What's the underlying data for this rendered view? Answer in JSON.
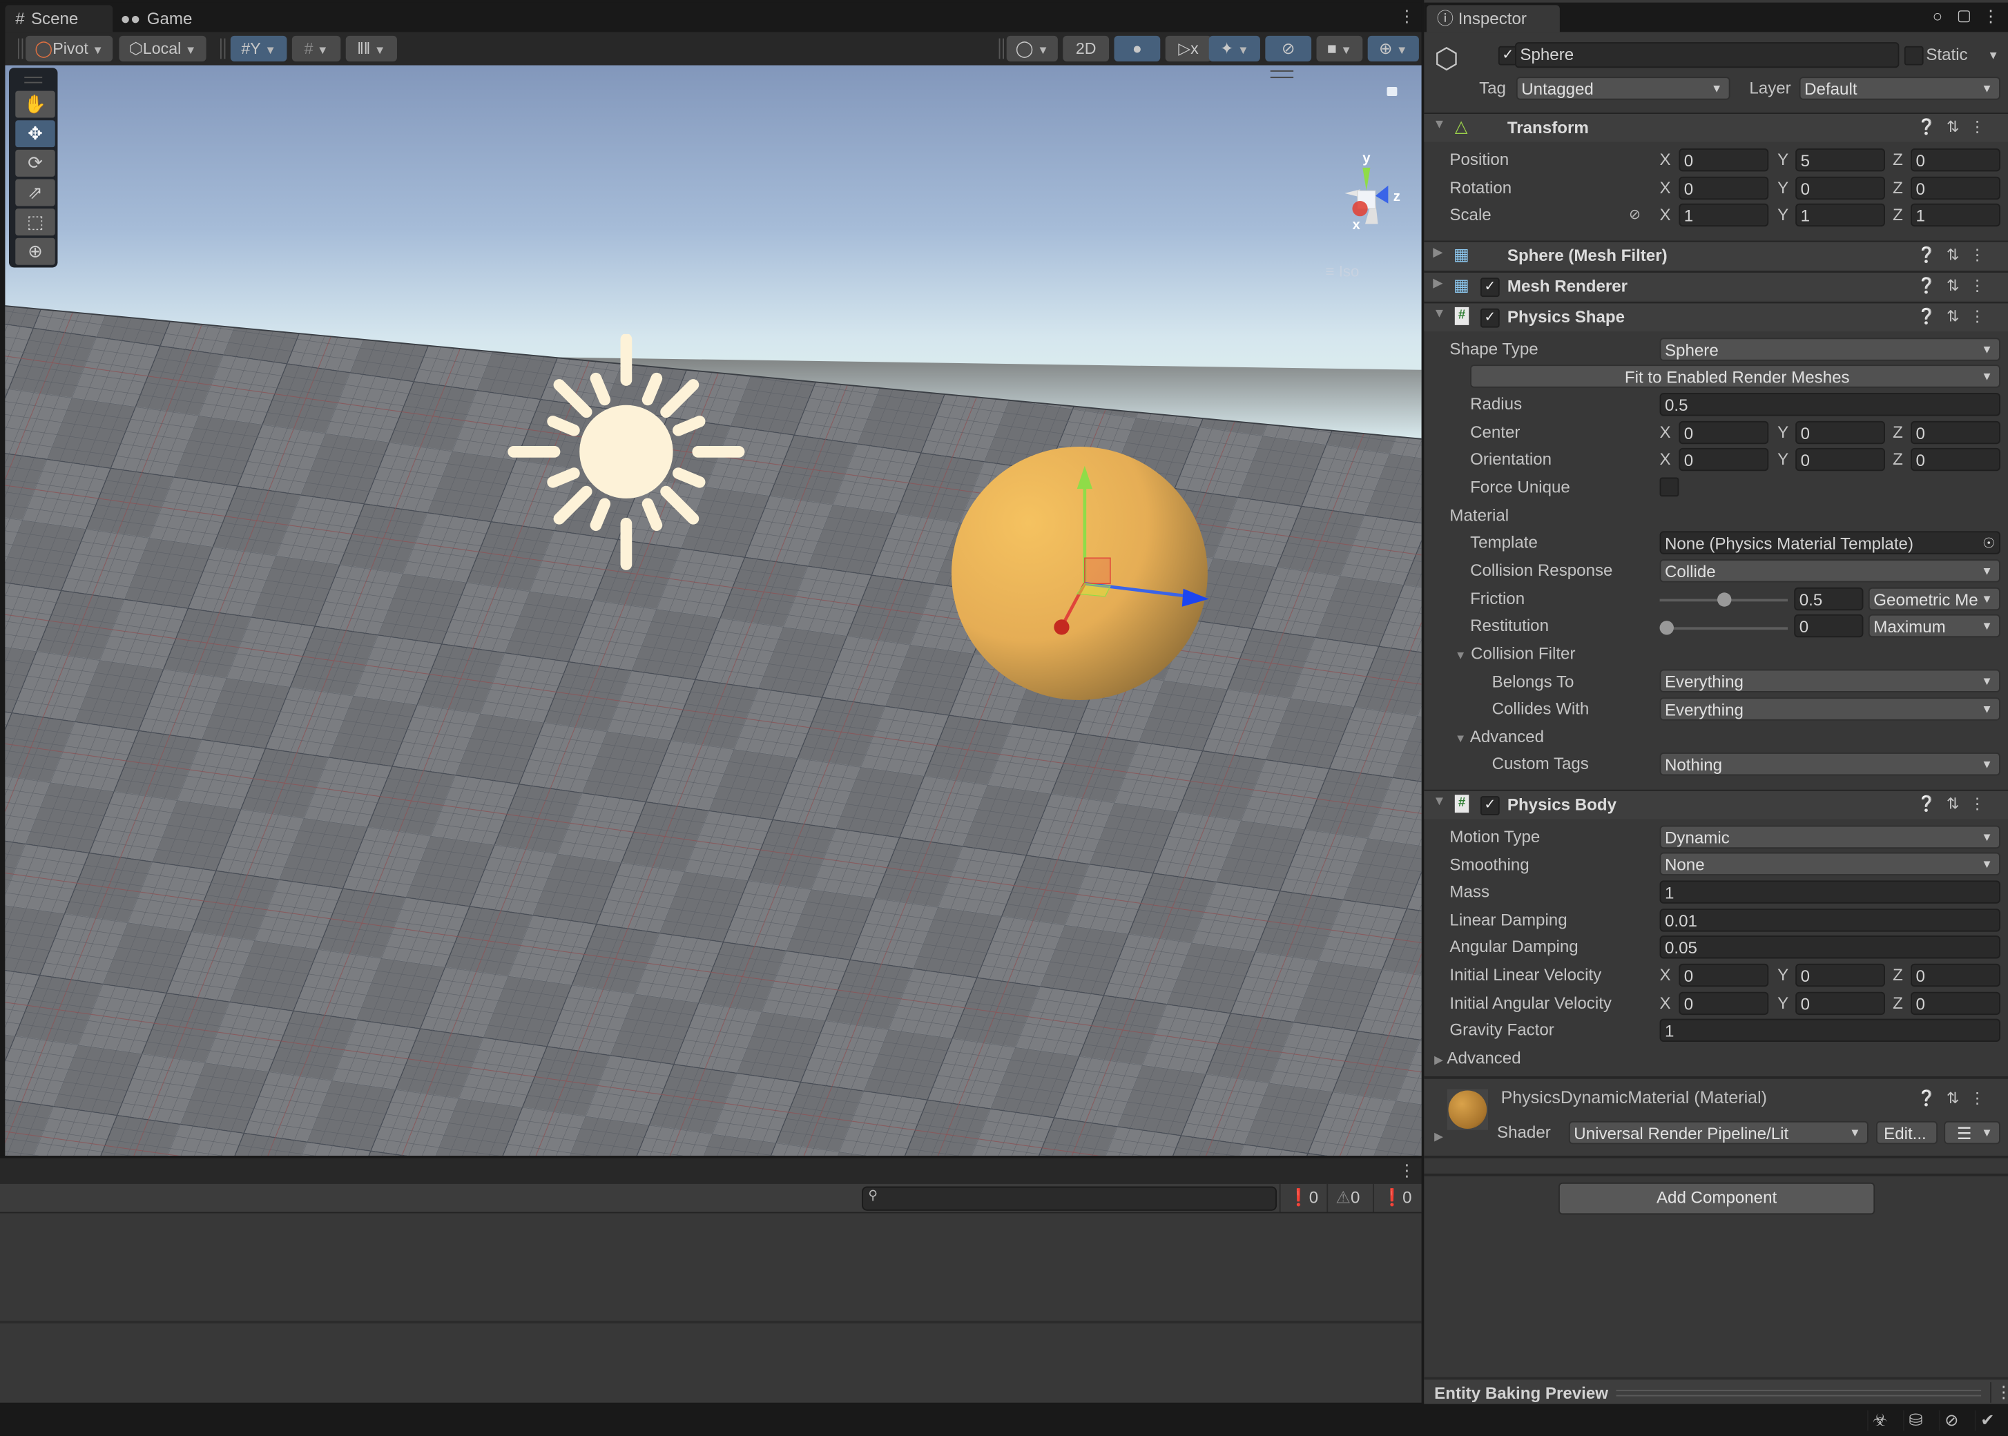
{
  "scene": {
    "tabs": [
      {
        "label": "Scene",
        "icon": "grid-icon",
        "active": true
      },
      {
        "label": "Game",
        "icon": "gamepad-icon",
        "active": false
      }
    ],
    "toolbar": {
      "pivot_label": "Pivot",
      "local_label": "Local",
      "mode_2d_label": "2D"
    },
    "tools": [
      "hand-tool",
      "move-tool",
      "rotate-tool",
      "scale-tool",
      "rect-tool",
      "transform-tool"
    ],
    "active_tool": "move-tool",
    "gizmo": {
      "x_label": "x",
      "y_label": "y",
      "z_label": "z",
      "projection_label": "Iso"
    }
  },
  "console": {
    "search_placeholder": "",
    "search_value": "",
    "log_count": "0",
    "warning_count": "0",
    "error_count": "0"
  },
  "inspector": {
    "tab_label": "Inspector",
    "object": {
      "name": "Sphere",
      "active": true,
      "static_label": "Static",
      "tag_label": "Tag",
      "tag_value": "Untagged",
      "layer_label": "Layer",
      "layer_value": "Default"
    },
    "transform": {
      "title": "Transform",
      "position": {
        "label": "Position",
        "x": "0",
        "y": "5",
        "z": "0"
      },
      "rotation": {
        "label": "Rotation",
        "x": "0",
        "y": "0",
        "z": "0"
      },
      "scale": {
        "label": "Scale",
        "x": "1",
        "y": "1",
        "z": "1"
      }
    },
    "mesh_filter": {
      "title": "Sphere (Mesh Filter)"
    },
    "mesh_renderer": {
      "title": "Mesh Renderer",
      "enabled": true
    },
    "physics_shape": {
      "title": "Physics Shape",
      "enabled": true,
      "shape_type_label": "Shape Type",
      "shape_type_value": "Sphere",
      "fit_button": "Fit to Enabled Render Meshes",
      "radius_label": "Radius",
      "radius_value": "0.5",
      "center": {
        "label": "Center",
        "x": "0",
        "y": "0",
        "z": "0"
      },
      "orientation": {
        "label": "Orientation",
        "x": "0",
        "y": "0",
        "z": "0"
      },
      "force_unique_label": "Force Unique",
      "force_unique": false,
      "material_label": "Material",
      "template_label": "Template",
      "template_value": "None (Physics Material Template)",
      "collision_response_label": "Collision Response",
      "collision_response_value": "Collide",
      "friction_label": "Friction",
      "friction_value": "0.5",
      "friction_slider": 0.5,
      "friction_combine": "Geometric Me",
      "restitution_label": "Restitution",
      "restitution_value": "0",
      "restitution_slider": 0,
      "restitution_combine": "Maximum",
      "collision_filter_label": "Collision Filter",
      "belongs_to_label": "Belongs To",
      "belongs_to_value": "Everything",
      "collides_with_label": "Collides With",
      "collides_with_value": "Everything",
      "advanced_label": "Advanced",
      "custom_tags_label": "Custom Tags",
      "custom_tags_value": "Nothing"
    },
    "physics_body": {
      "title": "Physics Body",
      "enabled": true,
      "motion_type_label": "Motion Type",
      "motion_type_value": "Dynamic",
      "smoothing_label": "Smoothing",
      "smoothing_value": "None",
      "mass_label": "Mass",
      "mass_value": "1",
      "linear_damping_label": "Linear Damping",
      "linear_damping_value": "0.01",
      "angular_damping_label": "Angular Damping",
      "angular_damping_value": "0.05",
      "initial_linear_velocity": {
        "label": "Initial Linear Velocity",
        "x": "0",
        "y": "0",
        "z": "0"
      },
      "initial_angular_velocity": {
        "label": "Initial Angular Velocity",
        "x": "0",
        "y": "0",
        "z": "0"
      },
      "gravity_factor_label": "Gravity Factor",
      "gravity_factor_value": "1",
      "advanced_label": "Advanced"
    },
    "material": {
      "title": "PhysicsDynamicMaterial (Material)",
      "shader_label": "Shader",
      "shader_value": "Universal Render Pipeline/Lit",
      "edit_label": "Edit...",
      "color": "#d9a24a"
    },
    "add_component_label": "Add Component",
    "baking_preview_label": "Entity Baking Preview"
  },
  "colors": {
    "accent_blue": "#46607c",
    "axis_x": "#e0453a",
    "axis_y": "#8fdc48",
    "axis_z": "#3a64e8",
    "sphere": "#e9b055",
    "sun": "#fdf2d8"
  }
}
